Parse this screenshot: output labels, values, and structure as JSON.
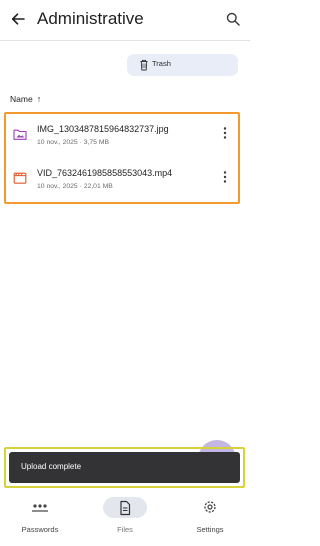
{
  "header": {
    "title": "Administrative"
  },
  "toolbar": {
    "trash_label": "Trash"
  },
  "sort": {
    "label": "Name",
    "direction_glyph": "↑"
  },
  "files": [
    {
      "name": "IMG_1303487815964832737.jpg",
      "meta": "10 nov., 2025 · 3,75 MB",
      "icon": "image-folder-icon",
      "icon_color": "#9c3db8"
    },
    {
      "name": "VID_7632461985858553043.mp4",
      "meta": "10 nov., 2025 · 22,01 MB",
      "icon": "video-icon",
      "icon_color": "#e0582c"
    }
  ],
  "toast": {
    "message": "Upload complete"
  },
  "nav": [
    {
      "label": "Passwords",
      "icon": "password-dots-icon",
      "active": false
    },
    {
      "label": "Files",
      "icon": "file-icon",
      "active": true
    },
    {
      "label": "Settings",
      "icon": "gear-icon",
      "active": false
    }
  ],
  "colors": {
    "accent": "#e8edf7",
    "toast_bg": "#333336",
    "highlight_files": "#f29a2e",
    "highlight_toast": "#d8d23a"
  }
}
